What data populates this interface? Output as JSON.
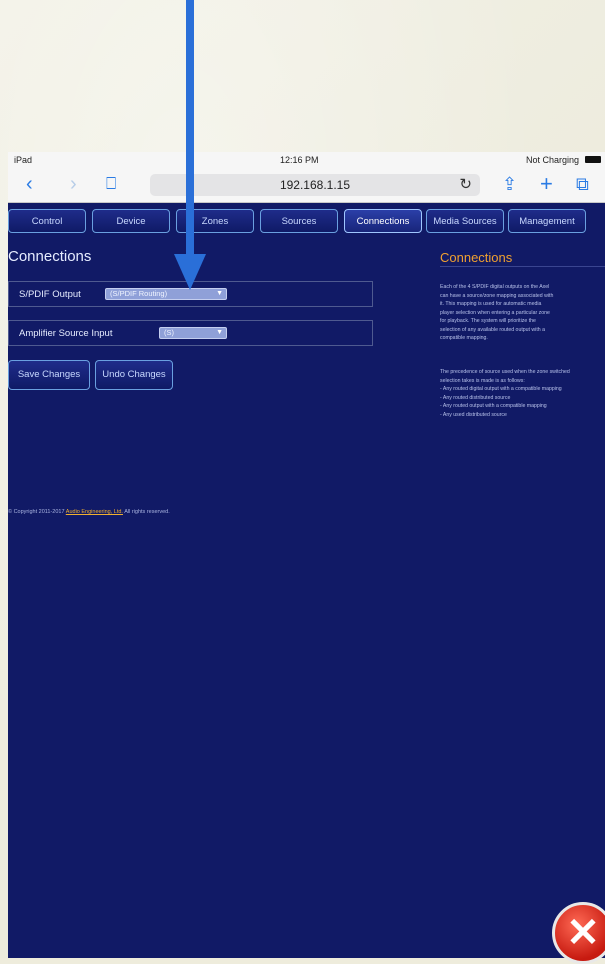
{
  "status_bar": {
    "device": "iPad",
    "time": "12:16 PM",
    "battery_text": "Not Charging"
  },
  "browser": {
    "url": "192.168.1.15",
    "icons": [
      "back-icon",
      "forward-icon",
      "bookmarks-icon",
      "reload-icon",
      "share-icon",
      "new-tab-icon",
      "tabs-icon"
    ]
  },
  "nav": {
    "tabs": [
      "Control",
      "Device",
      "Zones",
      "Sources",
      "Connections",
      "Media Sources",
      "Management"
    ],
    "active": "Connections"
  },
  "main": {
    "title": "Connections",
    "settings": [
      {
        "label": "S/PDIF Output",
        "value": "(S/PDIF Routing)"
      },
      {
        "label": "Amplifier Source Input",
        "value": "(S)"
      }
    ],
    "buttons": {
      "save": "Save Changes",
      "undo": "Undo Changes"
    },
    "copyright_prefix": "© Copyright 2011-2017",
    "copyright_link": "Audio Engineering, Ltd.",
    "copyright_suffix": "All rights reserved."
  },
  "help": {
    "title": "Connections",
    "para1": [
      "Each of the 4 S/PDIF digital outputs on the Axel",
      "can have a source/zone mapping associated with",
      "it. This mapping is used for automatic media",
      "player selection when entering a particular zone",
      "for playback. The system will prioritize the",
      "selection of any available routed output with a",
      "compatible mapping."
    ],
    "para2": [
      "The precedence of source used when the zone switched",
      "selection takes is made is as follows:",
      "- Any routed digital output with a compatible mapping",
      "- Any routed distributed source",
      "- Any routed output with a compatible mapping",
      "- Any used distributed source"
    ]
  },
  "colors": {
    "page_bg": "#111a66",
    "accent": "#f0a030",
    "arrow": "#2a6fd8"
  }
}
